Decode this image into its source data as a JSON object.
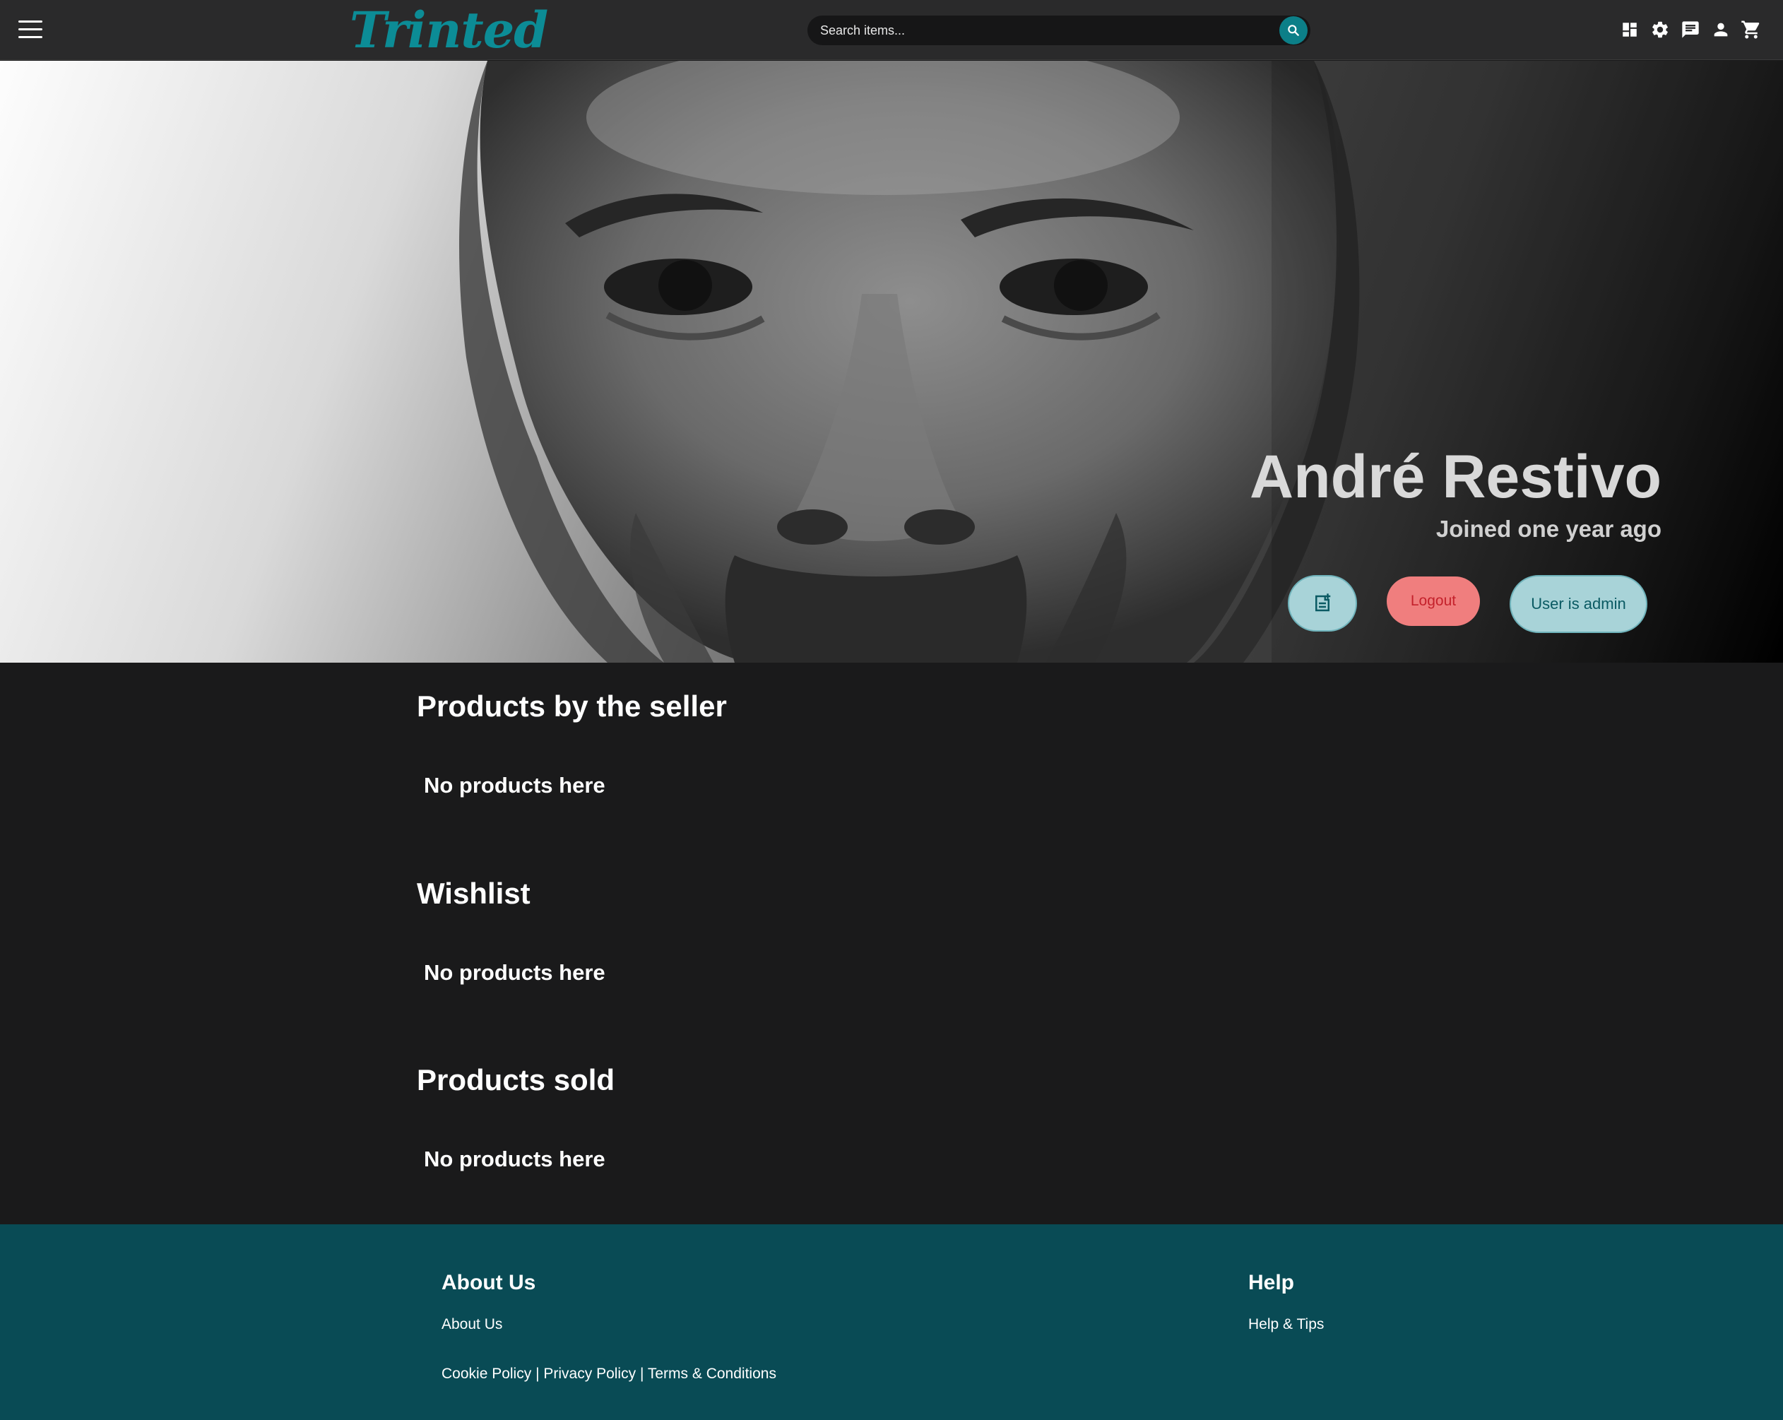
{
  "header": {
    "logo_text": "Trinted",
    "search_placeholder": "Search items...",
    "icons": [
      "menu-icon",
      "search-icon",
      "dashboard-icon",
      "gear-icon",
      "chat-icon",
      "user-icon",
      "cart-icon"
    ],
    "brand_color": "#0c8c96"
  },
  "profile": {
    "name": "André Restivo",
    "joined": "Joined one year ago",
    "logout_label": "Logout",
    "admin_label": "User is admin"
  },
  "sections": [
    {
      "title": "Products by the seller",
      "empty": "No products here"
    },
    {
      "title": "Wishlist",
      "empty": "No products here"
    },
    {
      "title": "Products sold",
      "empty": "No products here"
    }
  ],
  "footer": {
    "about_heading": "About Us",
    "about_link": "About Us",
    "help_heading": "Help",
    "help_link": "Help & Tips",
    "cookie_policy": "Cookie Policy",
    "privacy_policy": "Privacy Policy",
    "terms": "Terms & Conditions",
    "separator": "|",
    "background": "#094b55"
  }
}
